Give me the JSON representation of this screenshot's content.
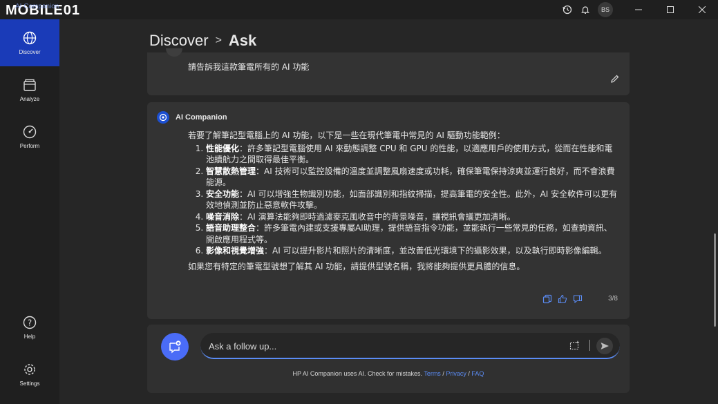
{
  "titlebar": {
    "logo_text": "MOBILE01",
    "ghost_title": "AI Companion",
    "avatar_initials": "BS",
    "icons": [
      "history-icon",
      "bell-icon",
      "minimize-icon",
      "maximize-icon",
      "close-icon"
    ]
  },
  "sidebar": {
    "items": [
      {
        "label": "Discover",
        "icon": "globe-icon",
        "active": true
      },
      {
        "label": "Analyze",
        "icon": "folder-icon",
        "active": false
      },
      {
        "label": "Perform",
        "icon": "gauge-icon",
        "active": false
      },
      {
        "label": "Help",
        "icon": "help-icon",
        "active": false
      },
      {
        "label": "Settings",
        "icon": "gear-icon",
        "active": false
      }
    ]
  },
  "breadcrumb": {
    "parent": "Discover",
    "separator": ">",
    "current": "Ask"
  },
  "user_message": {
    "text": "請告訴我這款筆電所有的 AI 功能"
  },
  "ai_message": {
    "sender": "AI Companion",
    "intro": "若要了解筆記型電腦上的 AI 功能，以下是一些在現代筆電中常見的 AI 驅動功能範例：",
    "items": [
      {
        "title": "性能優化",
        "text": "：許多筆記型電腦使用 AI 來動態調整 CPU 和 GPU 的性能，以適應用戶的使用方式，從而在性能和電池續航力之間取得最佳平衡。"
      },
      {
        "title": "智慧散熱管理",
        "text": "：AI 技術可以監控設備的溫度並調整風扇速度或功耗，確保筆電保持涼爽並運行良好，而不會浪費能源。"
      },
      {
        "title": "安全功能",
        "text": "：AI 可以增強生物識別功能，如面部識別和指紋掃描，提高筆電的安全性。此外，AI 安全軟件可以更有效地偵測並防止惡意軟件攻擊。"
      },
      {
        "title": "噪音消除",
        "text": "：AI 演算法能夠即時過濾麥克風收音中的背景噪音，讓視訊會議更加清晰。"
      },
      {
        "title": "語音助理整合",
        "text": "：許多筆電內建或支援專屬AI助理，提供語音指令功能，並能執行一些常見的任務，如查詢資訊、開啟應用程式等。"
      },
      {
        "title": "影像和視覺增強",
        "text": "：AI 可以提升影片和照片的清晰度，並改善低光環境下的攝影效果，以及執行即時影像編輯。"
      }
    ],
    "closing": "如果您有特定的筆電型號想了解其 AI 功能，請提供型號名稱，我將能夠提供更具體的信息。",
    "page_indicator": "3/8"
  },
  "composer": {
    "placeholder": "Ask a follow up...",
    "disclaimer": "HP AI Companion uses AI. Check for mistakes.",
    "links": {
      "terms": "Terms",
      "privacy": "Privacy",
      "faq": "FAQ"
    },
    "link_sep": "/"
  },
  "colors": {
    "accent": "#1a3bb8",
    "button": "#4a6cf7",
    "link": "#5b8cf5",
    "card": "#333333",
    "background": "#262626"
  }
}
